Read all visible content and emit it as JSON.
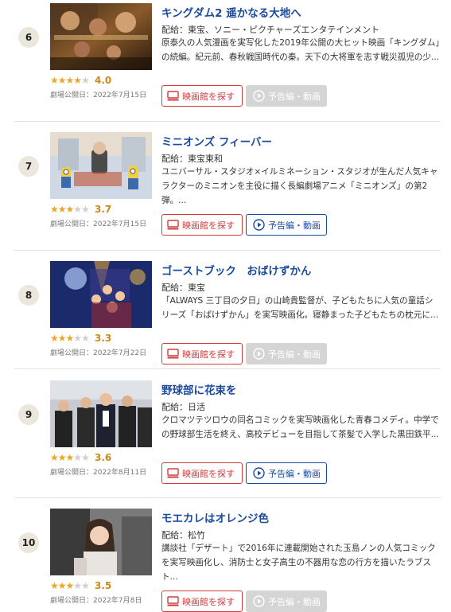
{
  "colors": {
    "title": "#1a4a9c",
    "theater_button": "#d33b3b",
    "star": "#e8a72a",
    "score": "#c98a1b",
    "disabled_button": "#d5d5d5"
  },
  "items": [
    {
      "rank": "6",
      "title": "キングダム2 遥かなる大地へ",
      "distributor": "配給：東宝、ソニー・ピクチャーズエンタテインメント",
      "description": "原泰久の人気漫画を実写化した2019年公開の大ヒット映画「キングダム」の続編。紀元前、春秋戦国時代の秦。天下の大将軍を志す戦災孤児の少...",
      "score": "4.0",
      "rating": 4.0,
      "release": "劇場公開日：2022年7月15日",
      "theater_label": "映画館を探す",
      "trailer_label": "予告編・動画",
      "trailer_enabled": false,
      "thumb": "kingdom"
    },
    {
      "rank": "7",
      "title": "ミニオンズ フィーバー",
      "distributor": "配給：東宝東和",
      "description": "ユニバーサル・スタジオ×イルミネーション・スタジオが生んだ人気キャラクターのミニオンを主役に描く長編劇場アニメ「ミニオンズ」の第2弾。...",
      "score": "3.7",
      "rating": 3.7,
      "release": "劇場公開日：2022年7月15日",
      "theater_label": "映画館を探す",
      "trailer_label": "予告編・動画",
      "trailer_enabled": true,
      "thumb": "minions"
    },
    {
      "rank": "8",
      "title": "ゴーストブック　おばけずかん",
      "distributor": "配給：東宝",
      "description": "「ALWAYS 三丁目の夕日」の山崎貴監督が、子どもたちに人気の童話シリーズ「おばけずかん」を実写映画化。寝静まった子どもたちの枕元に...",
      "score": "3.3",
      "rating": 3.3,
      "release": "劇場公開日：2022年7月22日",
      "theater_label": "映画館を探す",
      "trailer_label": "予告編・動画",
      "trailer_enabled": false,
      "thumb": "ghostbook"
    },
    {
      "rank": "9",
      "title": "野球部に花束を",
      "distributor": "配給：日活",
      "description": "クロマツテツロウの同名コミックを実写映画化した青春コメディ。中学での野球部生活を終え、高校デビューを目指して茶髪で入学した黒田鉄平...",
      "score": "3.6",
      "rating": 3.6,
      "release": "劇場公開日：2022年8月11日",
      "theater_label": "映画館を探す",
      "trailer_label": "予告編・動画",
      "trailer_enabled": true,
      "thumb": "baseball"
    },
    {
      "rank": "10",
      "title": "モエカレはオレンジ色",
      "distributor": "配給：松竹",
      "description": "講談社「デザート」で2016年に連載開始された玉島ノンの人気コミックを実写映画化し、消防士と女子高生の不器用な恋の行方を描いたラブスト...",
      "score": "3.5",
      "rating": 3.5,
      "release": "劇場公開日：2022年7月8日",
      "theater_label": "映画館を探す",
      "trailer_label": "予告編・動画",
      "trailer_enabled": false,
      "thumb": "moekare"
    }
  ]
}
